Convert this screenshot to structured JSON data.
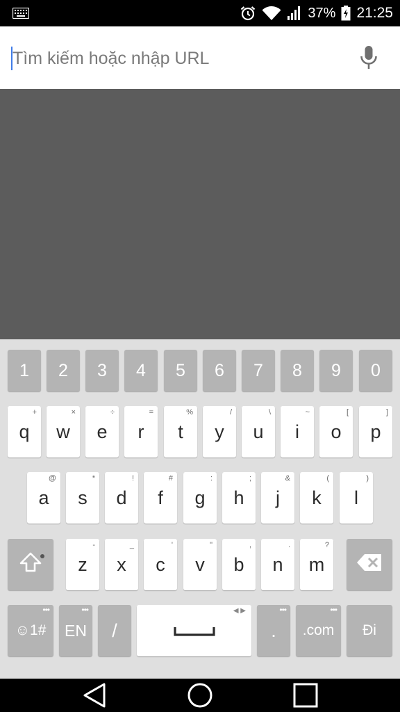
{
  "status_bar": {
    "battery_percent": "37%",
    "time": "21:25",
    "icons": [
      "keyboard-icon",
      "alarm-icon",
      "wifi-icon",
      "signal-icon",
      "battery-icon"
    ]
  },
  "search": {
    "placeholder": "Tìm kiếm hoặc nhập URL",
    "value": ""
  },
  "keyboard": {
    "number_row": [
      "1",
      "2",
      "3",
      "4",
      "5",
      "6",
      "7",
      "8",
      "9",
      "0"
    ],
    "row1": [
      {
        "label": "q",
        "hint": "+"
      },
      {
        "label": "w",
        "hint": "×"
      },
      {
        "label": "e",
        "hint": "÷"
      },
      {
        "label": "r",
        "hint": "="
      },
      {
        "label": "t",
        "hint": "%"
      },
      {
        "label": "y",
        "hint": "/"
      },
      {
        "label": "u",
        "hint": "\\"
      },
      {
        "label": "i",
        "hint": "~"
      },
      {
        "label": "o",
        "hint": "["
      },
      {
        "label": "p",
        "hint": "]"
      }
    ],
    "row2": [
      {
        "label": "a",
        "hint": "@"
      },
      {
        "label": "s",
        "hint": "*"
      },
      {
        "label": "d",
        "hint": "!"
      },
      {
        "label": "f",
        "hint": "#"
      },
      {
        "label": "g",
        "hint": ":"
      },
      {
        "label": "h",
        "hint": ";"
      },
      {
        "label": "j",
        "hint": "&"
      },
      {
        "label": "k",
        "hint": "("
      },
      {
        "label": "l",
        "hint": ")"
      }
    ],
    "row3": [
      {
        "label": "z",
        "hint": "-"
      },
      {
        "label": "x",
        "hint": "_"
      },
      {
        "label": "c",
        "hint": "'"
      },
      {
        "label": "v",
        "hint": "\""
      },
      {
        "label": "b",
        "hint": ","
      },
      {
        "label": "n",
        "hint": "."
      },
      {
        "label": "m",
        "hint": "?"
      }
    ],
    "symbols_key": "☺1#",
    "lang_key": "EN",
    "slash_key": "/",
    "period_key": ".",
    "dotcom_key": ".com",
    "go_key": "Đi"
  },
  "colors": {
    "keyboard_bg": "#dfdfdf",
    "key_light": "#ffffff",
    "key_dark": "#b4b4b4",
    "content_bg": "#5c5c5c",
    "cursor": "#3f7ce8"
  }
}
